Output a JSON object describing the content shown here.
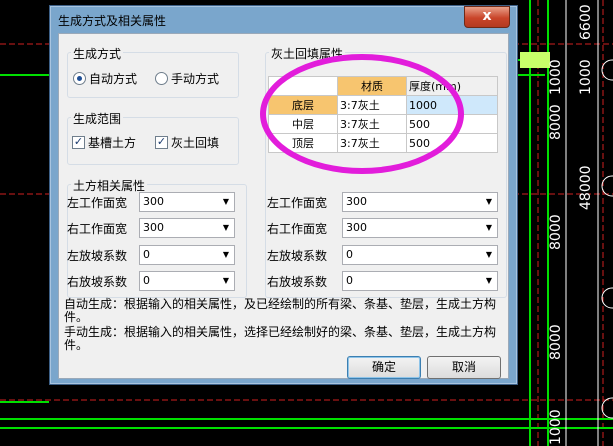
{
  "window": {
    "title": "生成方式及相关属性",
    "close_label": "x"
  },
  "gen_method": {
    "label": "生成方式",
    "auto": "自动方式",
    "manual": "手动方式",
    "selected": "auto"
  },
  "gen_scope": {
    "label": "生成范围",
    "foundation": "基槽土方",
    "lime": "灰土回填",
    "foundation_checked": true,
    "lime_checked": true
  },
  "earth_props": {
    "label": "土方相关属性",
    "rows": [
      {
        "label": "左工作面宽",
        "value": "300"
      },
      {
        "label": "右工作面宽",
        "value": "300"
      },
      {
        "label": "左放坡系数",
        "value": "0"
      },
      {
        "label": "右放坡系数",
        "value": "0"
      }
    ]
  },
  "lime_props": {
    "label": "灰土回填属性",
    "headers": [
      "",
      "材质",
      "厚度(mm)"
    ],
    "rows": [
      {
        "layer": "底层",
        "material": "3:7灰土",
        "thickness": "1000"
      },
      {
        "layer": "中层",
        "material": "3:7灰土",
        "thickness": "500"
      },
      {
        "layer": "顶层",
        "material": "3:7灰土",
        "thickness": "500"
      }
    ],
    "props": [
      {
        "label": "左工作面宽",
        "value": "300"
      },
      {
        "label": "右工作面宽",
        "value": "300"
      },
      {
        "label": "左放坡系数",
        "value": "0"
      },
      {
        "label": "右放坡系数",
        "value": "0"
      }
    ]
  },
  "notes": {
    "auto": "自动生成：根据输入的相关属性，及已经绘制的所有梁、条基、垫层，生成土方构件。",
    "manual": "手动生成：根据输入的相关属性，选择已经绘制好的梁、条基、垫层，生成土方构件。"
  },
  "buttons": {
    "ok": "确定",
    "cancel": "取消"
  },
  "cad_labels": {
    "d1": "6600",
    "d2": "1000",
    "d3": "1000",
    "d4": "48000",
    "d5": "8000",
    "d6": "8000",
    "d7": "8000",
    "d8": "1000"
  },
  "colors": {
    "accent": "#e21ddb",
    "cad_green": "#00e000",
    "cad_red": "#d02020"
  }
}
